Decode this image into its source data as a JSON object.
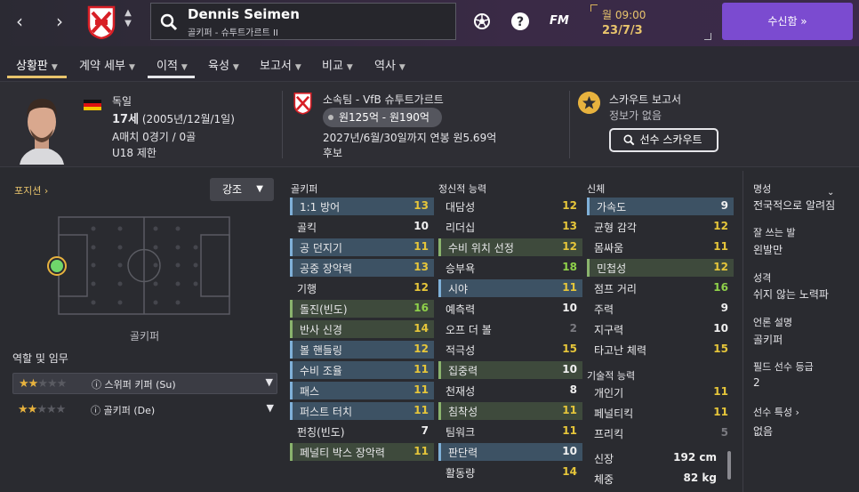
{
  "topbar": {
    "back_label": "‹",
    "forward_label": "›",
    "player_name": "Dennis Seimen",
    "player_sub": "골키퍼 - 슈투트가르트 II",
    "fm_label": "FM",
    "date_line1": "월 09:00",
    "date_line2": "23/7/3",
    "inbox_label": "수신함  »",
    "inbox_color": "#7b4bd0"
  },
  "tabs": [
    {
      "label": "상황판",
      "active": true
    },
    {
      "label": "계약 세부",
      "active": false
    },
    {
      "label": "이적",
      "active": false
    },
    {
      "label": "육성",
      "active": false
    },
    {
      "label": "보고서",
      "active": false
    },
    {
      "label": "비교",
      "active": false
    },
    {
      "label": "역사",
      "active": false
    }
  ],
  "header": {
    "nation": "독일",
    "age_bold": "17세",
    "age_rest": " (2005년/12월/1일)",
    "caps": "A매치 0경기 / 0골",
    "youth": "U18 제한",
    "club": "소속팀 - VfB 슈투트가르트",
    "value": "원125억 - 원190억",
    "contract": "2027년/6월/30일까지 연봉 원5.69억",
    "status": "후보",
    "scout_title": "스카우트 보고서",
    "scout_sub": "정보가 없음",
    "scout_button": "선수 스카우트"
  },
  "left": {
    "positions_label": "포지션 ›",
    "highlight_select": "강조",
    "pitch_label": "골키퍼",
    "roles_title": "역할 및 임무",
    "roles": [
      {
        "name": "스위퍼 키퍼 (Su)",
        "stars": 2,
        "selected": true
      },
      {
        "name": "골키퍼 (De)",
        "stars": 2,
        "selected": false
      }
    ]
  },
  "columns": {
    "gk_title": "골키퍼",
    "mental_title": "정신적 능력",
    "physical_title": "신체",
    "technical_title": "기술적 능력"
  },
  "goalkeeping": [
    {
      "name": "1:1 방어",
      "value": "13",
      "hl": "hl",
      "color": "v-y"
    },
    {
      "name": "골킥",
      "value": "10",
      "hl": "",
      "color": "v-w"
    },
    {
      "name": "공 던지기",
      "value": "11",
      "hl": "hl",
      "color": "v-y"
    },
    {
      "name": "공중 장악력",
      "value": "13",
      "hl": "hl",
      "color": "v-y"
    },
    {
      "name": "기행",
      "value": "12",
      "hl": "",
      "color": "v-y"
    },
    {
      "name": "돌진(빈도)",
      "value": "16",
      "hl": "hg",
      "color": "v-g"
    },
    {
      "name": "반사 신경",
      "value": "14",
      "hl": "hg",
      "color": "v-y"
    },
    {
      "name": "볼 핸들링",
      "value": "12",
      "hl": "hl",
      "color": "v-y"
    },
    {
      "name": "수비 조율",
      "value": "11",
      "hl": "hl",
      "color": "v-y"
    },
    {
      "name": "패스",
      "value": "11",
      "hl": "hl",
      "color": "v-y"
    },
    {
      "name": "퍼스트 터치",
      "value": "11",
      "hl": "hl",
      "color": "v-y"
    },
    {
      "name": "펀칭(빈도)",
      "value": "7",
      "hl": "",
      "color": "v-w"
    },
    {
      "name": "페널티 박스 장악력",
      "value": "11",
      "hl": "hg",
      "color": "v-y"
    }
  ],
  "mental": [
    {
      "name": "대담성",
      "value": "12",
      "hl": "",
      "color": "v-y"
    },
    {
      "name": "리더십",
      "value": "13",
      "hl": "",
      "color": "v-y"
    },
    {
      "name": "수비 위치 선정",
      "value": "12",
      "hl": "hg",
      "color": "v-y"
    },
    {
      "name": "승부욕",
      "value": "18",
      "hl": "",
      "color": "v-g"
    },
    {
      "name": "시야",
      "value": "11",
      "hl": "hl",
      "color": "v-y"
    },
    {
      "name": "예측력",
      "value": "10",
      "hl": "",
      "color": "v-w"
    },
    {
      "name": "오프 더 볼",
      "value": "2",
      "hl": "",
      "color": "v-dg"
    },
    {
      "name": "적극성",
      "value": "15",
      "hl": "",
      "color": "v-y"
    },
    {
      "name": "집중력",
      "value": "10",
      "hl": "hg",
      "color": "v-w"
    },
    {
      "name": "천재성",
      "value": "8",
      "hl": "",
      "color": "v-w"
    },
    {
      "name": "침착성",
      "value": "11",
      "hl": "hg",
      "color": "v-y"
    },
    {
      "name": "팀워크",
      "value": "11",
      "hl": "",
      "color": "v-y"
    },
    {
      "name": "판단력",
      "value": "10",
      "hl": "hl",
      "color": "v-w"
    },
    {
      "name": "활동량",
      "value": "14",
      "hl": "",
      "color": "v-y"
    }
  ],
  "physical": [
    {
      "name": "가속도",
      "value": "9",
      "hl": "hb",
      "color": "v-w"
    },
    {
      "name": "균형 감각",
      "value": "12",
      "hl": "",
      "color": "v-y"
    },
    {
      "name": "몸싸움",
      "value": "11",
      "hl": "",
      "color": "v-y"
    },
    {
      "name": "민첩성",
      "value": "12",
      "hl": "hg",
      "color": "v-y"
    },
    {
      "name": "점프 거리",
      "value": "16",
      "hl": "",
      "color": "v-g"
    },
    {
      "name": "주력",
      "value": "9",
      "hl": "",
      "color": "v-w"
    },
    {
      "name": "지구력",
      "value": "10",
      "hl": "",
      "color": "v-w"
    },
    {
      "name": "타고난 체력",
      "value": "15",
      "hl": "",
      "color": "v-y"
    }
  ],
  "technical": [
    {
      "name": "개인기",
      "value": "11",
      "hl": "",
      "color": "v-y"
    },
    {
      "name": "페널티킥",
      "value": "11",
      "hl": "",
      "color": "v-y"
    },
    {
      "name": "프리킥",
      "value": "5",
      "hl": "",
      "color": "v-dg"
    }
  ],
  "physique": [
    {
      "name": "신장",
      "value": "192 cm"
    },
    {
      "name": "체중",
      "value": "82 kg"
    }
  ],
  "right": {
    "rep_label": "명성",
    "rep_value": "전국적으로 알려짐",
    "foot_label": "잘 쓰는 발",
    "foot_value": "왼발만",
    "pers_label": "성격",
    "pers_value": "쉬지 않는 노력파",
    "media_label": "언론 설명",
    "media_value": "골키퍼",
    "outfield_label": "필드 선수 등급",
    "outfield_value": "2",
    "traits_label": "선수 특성 ›",
    "traits_value": "없음"
  }
}
